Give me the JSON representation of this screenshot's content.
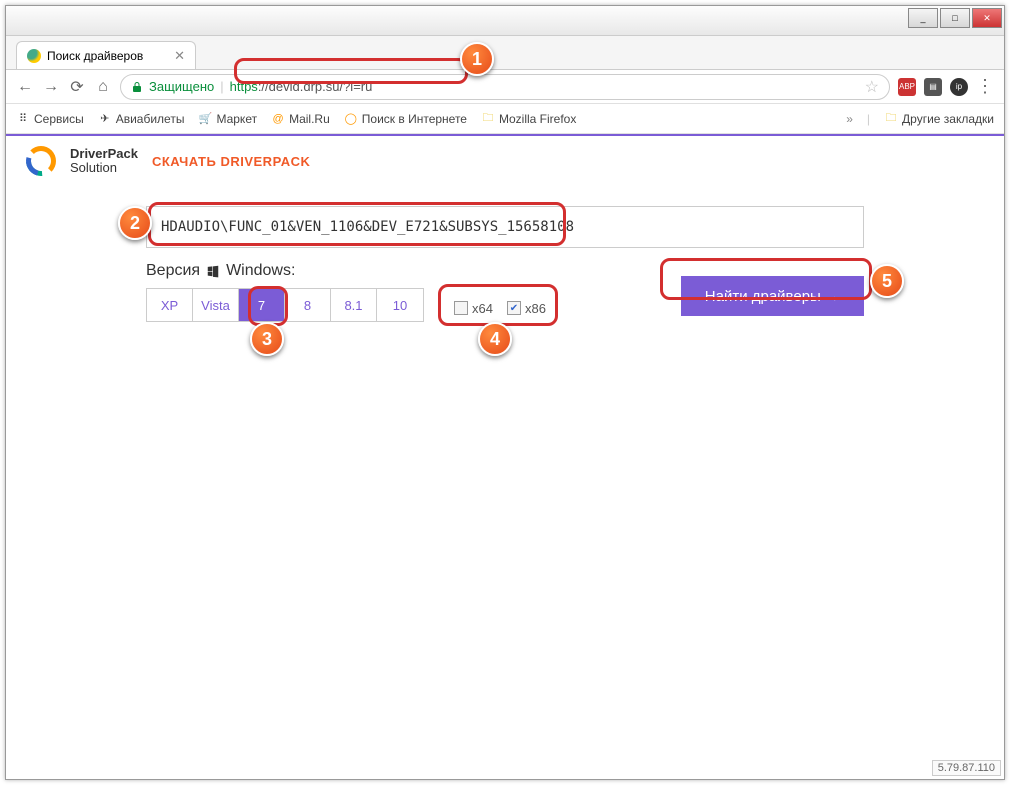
{
  "window": {
    "title_buttons": {
      "min": "_",
      "max": "□",
      "close": "✕"
    }
  },
  "tab": {
    "title": "Поиск драйверов",
    "close": "✕"
  },
  "nav": {
    "back": "←",
    "forward": "→",
    "reload": "⟳",
    "home": "⌂",
    "secure_label": "Защищено",
    "url_proto": "https",
    "url_rest": "://devid.drp.su/?l=ru",
    "star": "☆",
    "menu": "⋮"
  },
  "extensions": {
    "abp": "ABP",
    "ip": "ip"
  },
  "bookmarks": {
    "items": [
      {
        "label": "Сервисы",
        "icon": "apps"
      },
      {
        "label": "Авиабилеты",
        "icon": "plane"
      },
      {
        "label": "Маркет",
        "icon": "cart"
      },
      {
        "label": "Mail.Ru",
        "icon": "mail"
      },
      {
        "label": "Поиск в Интернете",
        "icon": "search"
      },
      {
        "label": "Mozilla Firefox",
        "icon": "folder"
      }
    ],
    "more": "»",
    "other": "Другие закладки"
  },
  "brand": {
    "line1": "DriverPack",
    "line2": "Solution",
    "download": "СКАЧАТЬ DRIVERPACK"
  },
  "search": {
    "value": "HDAUDIO\\FUNC_01&VEN_1106&DEV_E721&SUBSYS_15658108",
    "placeholder": ""
  },
  "version": {
    "label": "Версия",
    "os": "Windows:",
    "options": [
      "XP",
      "Vista",
      "7",
      "8",
      "8.1",
      "10"
    ],
    "selected": "7"
  },
  "arch": {
    "options": [
      {
        "label": "x64",
        "checked": false
      },
      {
        "label": "x86",
        "checked": true
      }
    ]
  },
  "find_button": "Найти драйверы →",
  "footer_version": "5.79.87.110",
  "markers": {
    "1": "1",
    "2": "2",
    "3": "3",
    "4": "4",
    "5": "5"
  }
}
